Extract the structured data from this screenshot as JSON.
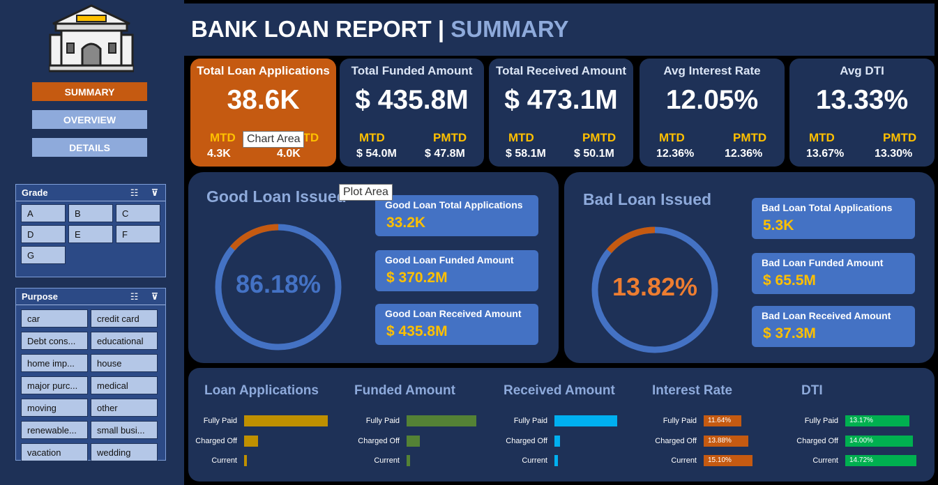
{
  "header": {
    "title": "BANK LOAN REPORT | ",
    "subtitle": "SUMMARY"
  },
  "nav": {
    "summary": "SUMMARY",
    "overview": "OVERVIEW",
    "details": "DETAILS"
  },
  "slicers": {
    "grade": {
      "title": "Grade",
      "items": [
        "A",
        "B",
        "C",
        "D",
        "E",
        "F",
        "G"
      ]
    },
    "purpose": {
      "title": "Purpose",
      "items": [
        "car",
        "credit card",
        "Debt cons...",
        "educational",
        "home imp...",
        "house",
        "major purc...",
        "medical",
        "moving",
        "other",
        "renewable...",
        "small busi...",
        "vacation",
        "wedding"
      ]
    }
  },
  "kpis": [
    {
      "label": "Total Loan Applications",
      "value": "38.6K",
      "mtd_label": "MTD",
      "mtd": "4.3K",
      "pmtd_label": "PMTD",
      "pmtd": "4.0K"
    },
    {
      "label": "Total Funded Amount",
      "value": "$ 435.8M",
      "mtd_label": "MTD",
      "mtd": "$ 54.0M",
      "pmtd_label": "PMTD",
      "pmtd": "$ 47.8M"
    },
    {
      "label": "Total Received Amount",
      "value": "$ 473.1M",
      "mtd_label": "MTD",
      "mtd": "$ 58.1M",
      "pmtd_label": "PMTD",
      "pmtd": "$ 50.1M"
    },
    {
      "label": "Avg Interest Rate",
      "value": "12.05%",
      "mtd_label": "MTD",
      "mtd": "12.36%",
      "pmtd_label": "PMTD",
      "pmtd": "12.36%"
    },
    {
      "label": "Avg DTI",
      "value": "13.33%",
      "mtd_label": "MTD",
      "mtd": "13.67%",
      "pmtd_label": "PMTD",
      "pmtd": "13.30%"
    }
  ],
  "good_loan": {
    "title": "Good Loan Issued",
    "percent_label": "86.18%",
    "percent": 86.18,
    "cards": [
      {
        "label": "Good Loan Total Applications",
        "value": "33.2K"
      },
      {
        "label": "Good Loan Funded Amount",
        "value": "$ 370.2M"
      },
      {
        "label": "Good Loan Received Amount",
        "value": "$ 435.8M"
      }
    ]
  },
  "bad_loan": {
    "title": "Bad Loan Issued",
    "percent_label": "13.82%",
    "percent": 13.82,
    "cards": [
      {
        "label": "Bad Loan Total Applications",
        "value": "5.3K"
      },
      {
        "label": "Bad Loan Funded Amount",
        "value": "$ 65.5M"
      },
      {
        "label": "Bad Loan Received Amount",
        "value": "$ 37.3M"
      }
    ]
  },
  "tooltips": {
    "chart_area": "Chart Area",
    "plot_area": "Plot Area"
  },
  "colors": {
    "navy": "#1e3157",
    "accent_orange": "#c55a11",
    "donut_blue": "#4472c4",
    "gold": "#ffc000",
    "pale_blue": "#8eaadb"
  },
  "chart_data": [
    {
      "type": "bar",
      "title": "Loan Applications",
      "categories": [
        "Fully Paid",
        "Charged Off",
        "Current"
      ],
      "values": [
        32145,
        5333,
        1098
      ],
      "color": "#bf9000",
      "show_labels": false
    },
    {
      "type": "bar",
      "title": "Funded Amount",
      "categories": [
        "Fully Paid",
        "Charged Off",
        "Current"
      ],
      "values": [
        351.4,
        65.5,
        18.9
      ],
      "color": "#548235",
      "show_labels": false
    },
    {
      "type": "bar",
      "title": "Received Amount",
      "categories": [
        "Fully Paid",
        "Charged Off",
        "Current"
      ],
      "values": [
        411.9,
        37.3,
        24.2
      ],
      "color": "#00b0f0",
      "show_labels": false
    },
    {
      "type": "bar",
      "title": "Interest Rate",
      "categories": [
        "Fully Paid",
        "Charged Off",
        "Current"
      ],
      "values": [
        11.64,
        13.88,
        15.1
      ],
      "labels": [
        "11.64%",
        "13.88%",
        "15.10%"
      ],
      "color": "#c55a11",
      "show_labels": true
    },
    {
      "type": "bar",
      "title": "DTI",
      "categories": [
        "Fully Paid",
        "Charged Off",
        "Current"
      ],
      "values": [
        13.17,
        14.0,
        14.72
      ],
      "labels": [
        "13.17%",
        "14.00%",
        "14.72%"
      ],
      "color": "#00b050",
      "show_labels": true
    }
  ]
}
